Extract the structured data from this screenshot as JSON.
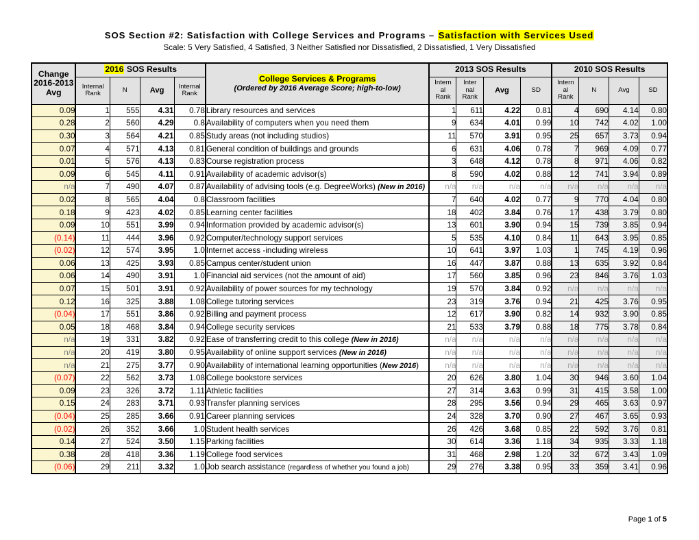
{
  "title": {
    "prefix": "SOS Section #2: Satisfaction with College Services and Programs – ",
    "highlight": "Satisfaction with Services Used",
    "subtitle": "Scale: 5 Very Satisfied, 4 Satisfied, 3 Neither Satisfied nor Dissatisfied, 2 Dissatisfied, 1 Very Dissatisfied"
  },
  "colors": {
    "highlight": "#ffff00",
    "change_column_bg": "#fbf6d0",
    "header_bg": "#e2e2e2",
    "year2010_bg": "#f1f1f1",
    "negative_text": "#ff0000",
    "na_text": "#a6a6a6"
  },
  "header": {
    "change_col": "Change\n2016-2013\nAvg",
    "change_line1": "Change",
    "change_line2": "2016-2013",
    "change_line3": "Avg",
    "group_2016_year": "2016",
    "group_2016_rest": " SOS Results",
    "group_2013": "2013 SOS Results",
    "group_2010": "2010 SOS Results",
    "desc_title": "College Services & Programs",
    "desc_subtitle": "(Ordered by 2016 Average Score; high-to-low)",
    "sub_2016": [
      "Internal\nRank",
      "N",
      "Avg",
      "Internal\nRank"
    ],
    "sub_2016_a": "Internal",
    "sub_2016_a2": "Rank",
    "sub_2016_b": "N",
    "sub_2016_c": "Avg",
    "sub_2016_d": "Internal",
    "sub_2016_d2": "Rank",
    "sub_2013_a": "Intern",
    "sub_2013_a2": "al",
    "sub_2013_a3": "Rank",
    "sub_2013_b": "Inter",
    "sub_2013_b2": "nal",
    "sub_2013_b3": "Rank",
    "sub_2013_c": "Avg",
    "sub_2013_d": "SD",
    "sub_2010_a": "Intern",
    "sub_2010_a2": "al",
    "sub_2010_a3": "Rank",
    "sub_2010_b": "N",
    "sub_2010_c": "Avg",
    "sub_2010_d": "SD"
  },
  "rows": [
    {
      "change": "0.09",
      "neg": false,
      "r16": "1",
      "n16": "555",
      "avg16": "4.31",
      "sd16": "0.78",
      "desc": "Library resources and services",
      "note": "",
      "r13a": "1",
      "r13b": "611",
      "avg13": "4.22",
      "sd13": "0.81",
      "r10": "4",
      "n10": "690",
      "avg10": "4.14",
      "sd10": "0.80"
    },
    {
      "change": "0.28",
      "neg": false,
      "r16": "2",
      "n16": "560",
      "avg16": "4.29",
      "sd16": "0.8",
      "desc": "Availability of computers when you need them",
      "note": "",
      "r13a": "9",
      "r13b": "634",
      "avg13": "4.01",
      "sd13": "0.99",
      "r10": "10",
      "n10": "742",
      "avg10": "4.02",
      "sd10": "1.00"
    },
    {
      "change": "0.30",
      "neg": false,
      "r16": "3",
      "n16": "564",
      "avg16": "4.21",
      "sd16": "0.85",
      "desc": "Study areas (not including studios)",
      "note": "",
      "r13a": "11",
      "r13b": "570",
      "avg13": "3.91",
      "sd13": "0.95",
      "r10": "25",
      "n10": "657",
      "avg10": "3.73",
      "sd10": "0.94"
    },
    {
      "change": "0.07",
      "neg": false,
      "r16": "4",
      "n16": "571",
      "avg16": "4.13",
      "sd16": "0.81",
      "desc": "General condition of buildings and grounds",
      "note": "",
      "r13a": "6",
      "r13b": "631",
      "avg13": "4.06",
      "sd13": "0.78",
      "r10": "7",
      "n10": "969",
      "avg10": "4.09",
      "sd10": "0.77"
    },
    {
      "change": "0.01",
      "neg": false,
      "r16": "5",
      "n16": "576",
      "avg16": "4.13",
      "sd16": "0.83",
      "desc": "Course registration process",
      "note": "",
      "r13a": "3",
      "r13b": "648",
      "avg13": "4.12",
      "sd13": "0.78",
      "r10": "8",
      "n10": "971",
      "avg10": "4.06",
      "sd10": "0.82"
    },
    {
      "change": "0.09",
      "neg": false,
      "r16": "6",
      "n16": "545",
      "avg16": "4.11",
      "sd16": "0.91",
      "desc": "Availability of academic advisor(s)",
      "note": "",
      "r13a": "8",
      "r13b": "590",
      "avg13": "4.02",
      "sd13": "0.88",
      "r10": "12",
      "n10": "741",
      "avg10": "3.94",
      "sd10": "0.89"
    },
    {
      "change": "n/a",
      "neg": false,
      "na_change": true,
      "r16": "7",
      "n16": "490",
      "avg16": "4.07",
      "sd16": "0.87",
      "desc": "Availability of advising tools (e.g. DegreeWorks) ",
      "note": "(New in 2016)",
      "r13a": "n/a",
      "r13b": "n/a",
      "avg13": "n/a",
      "sd13": "n/a",
      "r10": "n/a",
      "n10": "n/a",
      "avg10": "n/a",
      "sd10": "n/a",
      "na13": true,
      "na10": true
    },
    {
      "change": "0.02",
      "neg": false,
      "r16": "8",
      "n16": "565",
      "avg16": "4.04",
      "sd16": "0.8",
      "desc": "Classroom facilities",
      "note": "",
      "r13a": "7",
      "r13b": "640",
      "avg13": "4.02",
      "sd13": "0.77",
      "r10": "9",
      "n10": "770",
      "avg10": "4.04",
      "sd10": "0.80"
    },
    {
      "change": "0.18",
      "neg": false,
      "r16": "9",
      "n16": "423",
      "avg16": "4.02",
      "sd16": "0.85",
      "desc": "Learning center facilities",
      "note": "",
      "r13a": "18",
      "r13b": "402",
      "avg13": "3.84",
      "sd13": "0.76",
      "r10": "17",
      "n10": "438",
      "avg10": "3.79",
      "sd10": "0.80"
    },
    {
      "change": "0.09",
      "neg": false,
      "r16": "10",
      "n16": "551",
      "avg16": "3.99",
      "sd16": "0.94",
      "desc": "Information provided by academic advisor(s)",
      "note": "",
      "r13a": "13",
      "r13b": "601",
      "avg13": "3.90",
      "sd13": "0.94",
      "r10": "15",
      "n10": "739",
      "avg10": "3.85",
      "sd10": "0.94"
    },
    {
      "change": "(0.14)",
      "neg": true,
      "r16": "11",
      "n16": "444",
      "avg16": "3.96",
      "sd16": "0.92",
      "desc": "Computer/technology support services",
      "note": "",
      "r13a": "5",
      "r13b": "535",
      "avg13": "4.10",
      "sd13": "0.84",
      "r10": "11",
      "n10": "643",
      "avg10": "3.95",
      "sd10": "0.85"
    },
    {
      "change": "(0.02)",
      "neg": true,
      "r16": "12",
      "n16": "574",
      "avg16": "3.95",
      "sd16": "1.0",
      "desc": "Internet access -including wireless",
      "note": "",
      "r13a": "10",
      "r13b": "641",
      "avg13": "3.97",
      "sd13": "1.03",
      "r10": "1",
      "n10": "745",
      "avg10": "4.19",
      "sd10": "0.96"
    },
    {
      "change": "0.06",
      "neg": false,
      "r16": "13",
      "n16": "425",
      "avg16": "3.93",
      "sd16": "0.85",
      "desc": "Campus center/student union",
      "note": "",
      "r13a": "16",
      "r13b": "447",
      "avg13": "3.87",
      "sd13": "0.88",
      "r10": "13",
      "n10": "635",
      "avg10": "3.92",
      "sd10": "0.84"
    },
    {
      "change": "0.06",
      "neg": false,
      "r16": "14",
      "n16": "490",
      "avg16": "3.91",
      "sd16": "1.0",
      "desc": "Financial aid services (not the amount of aid)",
      "note": "",
      "r13a": "17",
      "r13b": "560",
      "avg13": "3.85",
      "sd13": "0.96",
      "r10": "23",
      "n10": "846",
      "avg10": "3.76",
      "sd10": "1.03"
    },
    {
      "change": "0.07",
      "neg": false,
      "r16": "15",
      "n16": "501",
      "avg16": "3.91",
      "sd16": "0.92",
      "desc": "Availability of power sources for my technology",
      "note": "",
      "r13a": "19",
      "r13b": "570",
      "avg13": "3.84",
      "sd13": "0.92",
      "r10": "n/a",
      "n10": "n/a",
      "avg10": "n/a",
      "sd10": "n/a",
      "na10": true
    },
    {
      "change": "0.12",
      "neg": false,
      "r16": "16",
      "n16": "325",
      "avg16": "3.88",
      "sd16": "1.08",
      "desc": "College tutoring services",
      "note": "",
      "r13a": "23",
      "r13b": "319",
      "avg13": "3.76",
      "sd13": "0.94",
      "r10": "21",
      "n10": "425",
      "avg10": "3.76",
      "sd10": "0.95"
    },
    {
      "change": "(0.04)",
      "neg": true,
      "r16": "17",
      "n16": "551",
      "avg16": "3.86",
      "sd16": "0.92",
      "desc": "Billing and payment process",
      "note": "",
      "r13a": "12",
      "r13b": "617",
      "avg13": "3.90",
      "sd13": "0.82",
      "r10": "14",
      "n10": "932",
      "avg10": "3.90",
      "sd10": "0.85"
    },
    {
      "change": "0.05",
      "neg": false,
      "r16": "18",
      "n16": "468",
      "avg16": "3.84",
      "sd16": "0.94",
      "desc": "College security services",
      "note": "",
      "r13a": "21",
      "r13b": "533",
      "avg13": "3.79",
      "sd13": "0.88",
      "r10": "18",
      "n10": "775",
      "avg10": "3.78",
      "sd10": "0.84"
    },
    {
      "change": "n/a",
      "neg": false,
      "na_change": true,
      "r16": "19",
      "n16": "331",
      "avg16": "3.82",
      "sd16": "0.92",
      "desc": "Ease of transferring credit to this college ",
      "note": "(New in 2016)",
      "r13a": "n/a",
      "r13b": "n/a",
      "avg13": "n/a",
      "sd13": "n/a",
      "r10": "n/a",
      "n10": "n/a",
      "avg10": "n/a",
      "sd10": "n/a",
      "na13": true,
      "na10": true
    },
    {
      "change": "n/a",
      "neg": false,
      "na_change": true,
      "r16": "20",
      "n16": "419",
      "avg16": "3.80",
      "sd16": "0.95",
      "desc": "Availability of online support services ",
      "note": "(New in 2016)",
      "r13a": "n/a",
      "r13b": "n/a",
      "avg13": "n/a",
      "sd13": "n/a",
      "r10": "n/a",
      "n10": "n/a",
      "avg10": "n/a",
      "sd10": "n/a",
      "na13": true,
      "na10": true
    },
    {
      "change": "n/a",
      "neg": false,
      "na_change": true,
      "r16": "21",
      "n16": "275",
      "avg16": "3.77",
      "sd16": "0.90",
      "desc": "Availability of international learning opportunities ",
      "note": "(New 2016)",
      "note_open_plain": true,
      "r13a": "n/a",
      "r13b": "n/a",
      "avg13": "n/a",
      "sd13": "n/a",
      "r10": "n/a",
      "n10": "n/a",
      "avg10": "n/a",
      "sd10": "n/a",
      "na13": true,
      "na10": true
    },
    {
      "change": "(0.07)",
      "neg": true,
      "r16": "22",
      "n16": "562",
      "avg16": "3.73",
      "sd16": "1.08",
      "desc": "College bookstore services",
      "note": "",
      "r13a": "20",
      "r13b": "626",
      "avg13": "3.80",
      "sd13": "1.04",
      "r10": "30",
      "n10": "946",
      "avg10": "3.60",
      "sd10": "1.04"
    },
    {
      "change": "0.09",
      "neg": false,
      "r16": "23",
      "n16": "326",
      "avg16": "3.72",
      "sd16": "1.11",
      "desc": "Athletic facilities",
      "note": "",
      "r13a": "27",
      "r13b": "314",
      "avg13": "3.63",
      "sd13": "0.99",
      "r10": "31",
      "n10": "415",
      "avg10": "3.58",
      "sd10": "1.00"
    },
    {
      "change": "0.15",
      "neg": false,
      "r16": "24",
      "n16": "283",
      "avg16": "3.71",
      "sd16": "0.93",
      "desc": "Transfer planning services",
      "note": "",
      "r13a": "28",
      "r13b": "295",
      "avg13": "3.56",
      "sd13": "0.94",
      "r10": "29",
      "n10": "465",
      "avg10": "3.63",
      "sd10": "0.97"
    },
    {
      "change": "(0.04)",
      "neg": true,
      "r16": "25",
      "n16": "285",
      "avg16": "3.66",
      "sd16": "0.91",
      "desc": "Career planning services",
      "note": "",
      "r13a": "24",
      "r13b": "328",
      "avg13": "3.70",
      "sd13": "0.90",
      "r10": "27",
      "n10": "467",
      "avg10": "3.65",
      "sd10": "0.93"
    },
    {
      "change": "(0.02)",
      "neg": true,
      "r16": "26",
      "n16": "352",
      "avg16": "3.66",
      "sd16": "1.0",
      "desc": "Student health services",
      "note": "",
      "r13a": "26",
      "r13b": "426",
      "avg13": "3.68",
      "sd13": "0.85",
      "r10": "22",
      "n10": "592",
      "avg10": "3.76",
      "sd10": "0.81"
    },
    {
      "change": "0.14",
      "neg": false,
      "r16": "27",
      "n16": "524",
      "avg16": "3.50",
      "sd16": "1.15",
      "desc": "Parking facilities",
      "note": "",
      "r13a": "30",
      "r13b": "614",
      "avg13": "3.36",
      "sd13": "1.18",
      "r10": "34",
      "n10": "935",
      "avg10": "3.33",
      "sd10": "1.18"
    },
    {
      "change": "0.38",
      "neg": false,
      "r16": "28",
      "n16": "418",
      "avg16": "3.36",
      "sd16": "1.19",
      "desc": "College food services",
      "note": "",
      "r13a": "31",
      "r13b": "468",
      "avg13": "2.98",
      "sd13": "1.20",
      "r10": "32",
      "n10": "672",
      "avg10": "3.43",
      "sd10": "1.09"
    },
    {
      "change": "(0.06)",
      "neg": true,
      "r16": "29",
      "n16": "211",
      "avg16": "3.32",
      "sd16": "1.0",
      "desc": "Job search assistance ",
      "note": "(regardless of whether you found a job)",
      "note_small": true,
      "r13a": "29",
      "r13b": "276",
      "avg13": "3.38",
      "sd13": "0.95",
      "r10": "33",
      "n10": "359",
      "avg10": "3.41",
      "sd10": "0.96"
    }
  ],
  "footer": {
    "prefix": "Page ",
    "page": "1",
    "middle": " of ",
    "total": "5"
  }
}
